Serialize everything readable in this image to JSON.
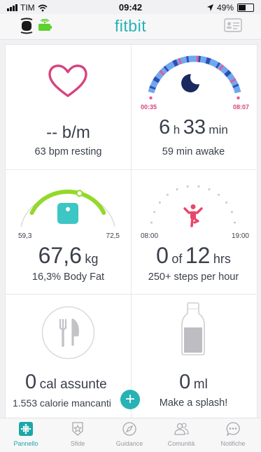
{
  "status_bar": {
    "carrier": "TIM",
    "time": "09:42",
    "battery": "49%"
  },
  "header": {
    "logo": "fitbit"
  },
  "tiles": {
    "heart": {
      "value": "-- b/m",
      "sub": "63 bpm resting"
    },
    "sleep": {
      "start": "00:35",
      "end": "08:07",
      "hours": "6",
      "h_unit": "h",
      "minutes": "33",
      "m_unit": "min",
      "sub": "59 min awake"
    },
    "weight": {
      "left": "59,3",
      "right": "72,5",
      "value": "67,6",
      "unit": "kg",
      "sub": "16,3% Body Fat",
      "level": 0.63
    },
    "hourly": {
      "start": "08:00",
      "end": "19:00",
      "value": "0",
      "of": "of",
      "target": "12",
      "unit": "hrs",
      "sub": "250+ steps per hour"
    },
    "food": {
      "value": "0",
      "unit": "cal assunte",
      "sub": "1.553 calorie mancanti"
    },
    "water": {
      "value": "0",
      "unit": "ml",
      "sub": "Make a splash!"
    }
  },
  "fab": {
    "label": "+"
  },
  "nav": [
    {
      "label": "Pannello",
      "icon": "dashboard-icon",
      "active": true
    },
    {
      "label": "Sfide",
      "icon": "challenges-icon"
    },
    {
      "label": "Guidance",
      "icon": "compass-icon"
    },
    {
      "label": "Comunità",
      "icon": "community-icon"
    },
    {
      "label": "Notifiche",
      "icon": "notifications-icon"
    }
  ],
  "colors": {
    "accent": "#27b3b3",
    "heart": "#d6457f",
    "weight_arc": "#94d92a",
    "activity": "#e8476b",
    "sleep_deep": "#2c4fb5",
    "sleep_light": "#6fa8f0",
    "sleep_awake": "#e85a8c"
  }
}
